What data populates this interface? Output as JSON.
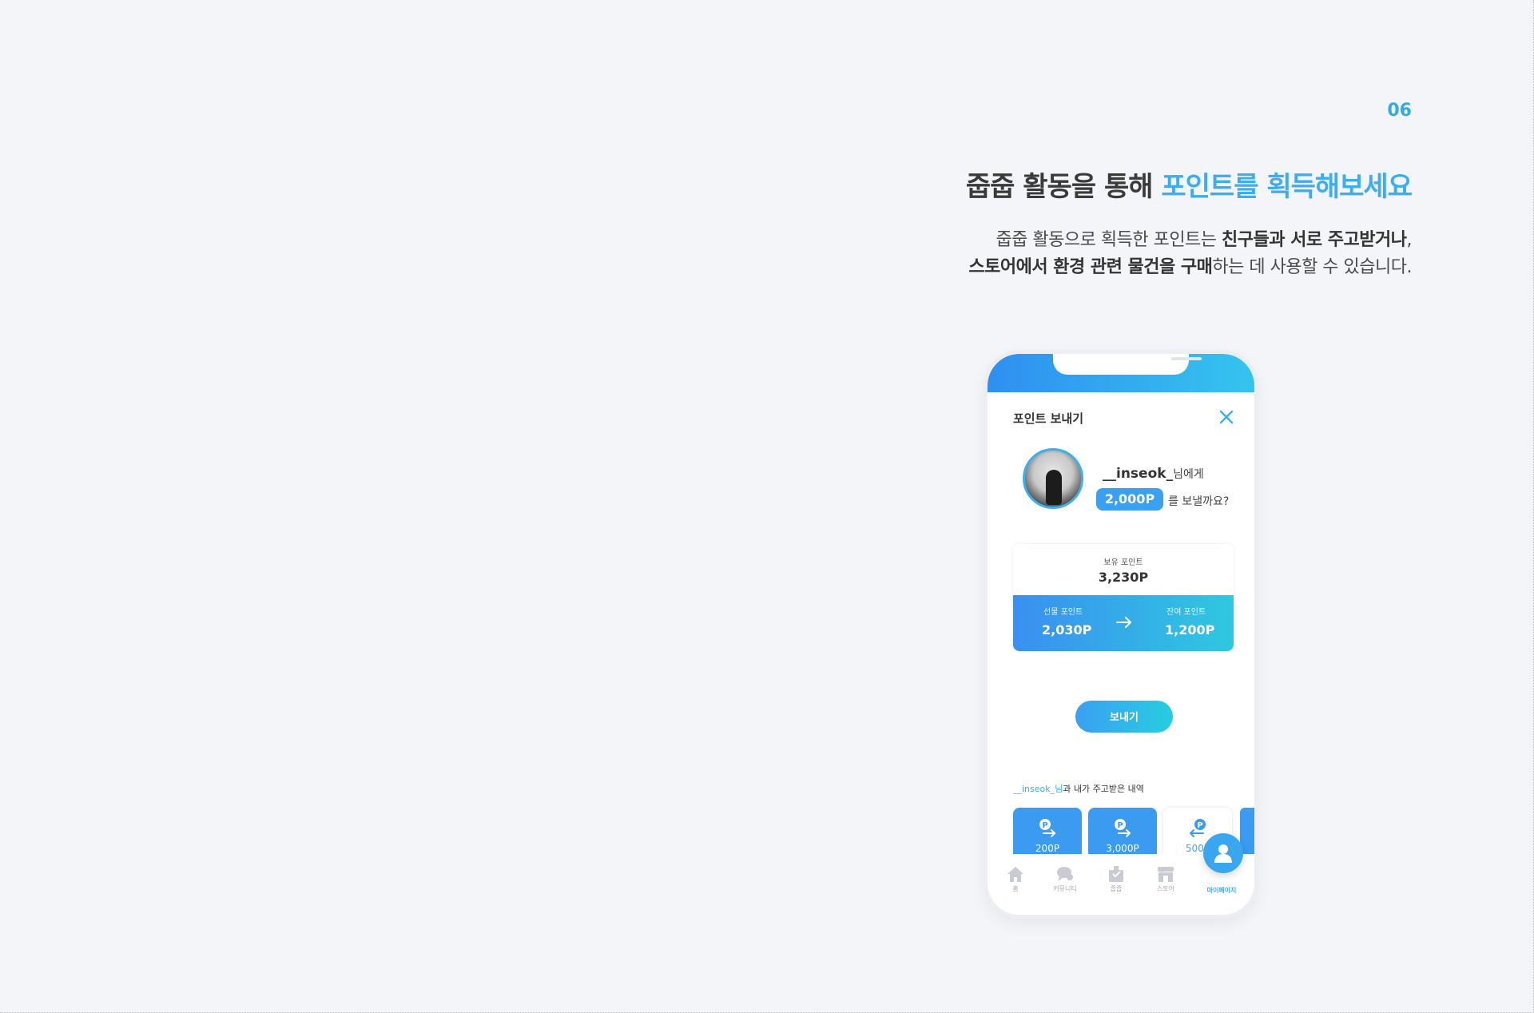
{
  "page": {
    "number": "06",
    "headline_plain": "줍줍 활동을 통해 ",
    "headline_accent": "포인트를 획득해보세요",
    "desc_line1_plain": "줍줍 활동으로 획득한 포인트는 ",
    "desc_line1_bold": "친구들과 서로 주고받거나",
    "desc_line1_end": ",",
    "desc_line2_bold": "스토어에서 환경 관련 물건을 구매",
    "desc_line2_plain": "하는 데 사용할 수 있습니다."
  },
  "screen": {
    "title": "포인트 보내기",
    "recipient_name": "__inseok_",
    "recipient_suffix": "님에게",
    "amount": "2,000P",
    "send_question": "를 보낼까요?",
    "balance_label": "보유 포인트",
    "balance_value": "3,230P",
    "gift_label": "선물 포인트",
    "gift_value": "2,030P",
    "remain_label": "잔여 포인트",
    "remain_value": "1,200P",
    "send_button": "보내기",
    "history_highlight": "__inseok_님",
    "history_rest": "과 내가 주고받은 내역",
    "history": [
      {
        "amount": "200P",
        "direction": "sent"
      },
      {
        "amount": "3,000P",
        "direction": "sent"
      },
      {
        "amount": "500P",
        "direction": "received"
      }
    ],
    "tabs": [
      {
        "label": "홈",
        "icon": "home-icon"
      },
      {
        "label": "커뮤니티",
        "icon": "chat-icon"
      },
      {
        "label": "줍줍",
        "icon": "pickup-icon"
      },
      {
        "label": "스토어",
        "icon": "store-icon"
      },
      {
        "label": "마이페이지",
        "icon": "user-icon"
      }
    ]
  },
  "colors": {
    "accent": "#3aaef0",
    "background": "#f3f5f9",
    "gradient_start": "#3a8ff0",
    "gradient_end": "#2fc8e0"
  }
}
